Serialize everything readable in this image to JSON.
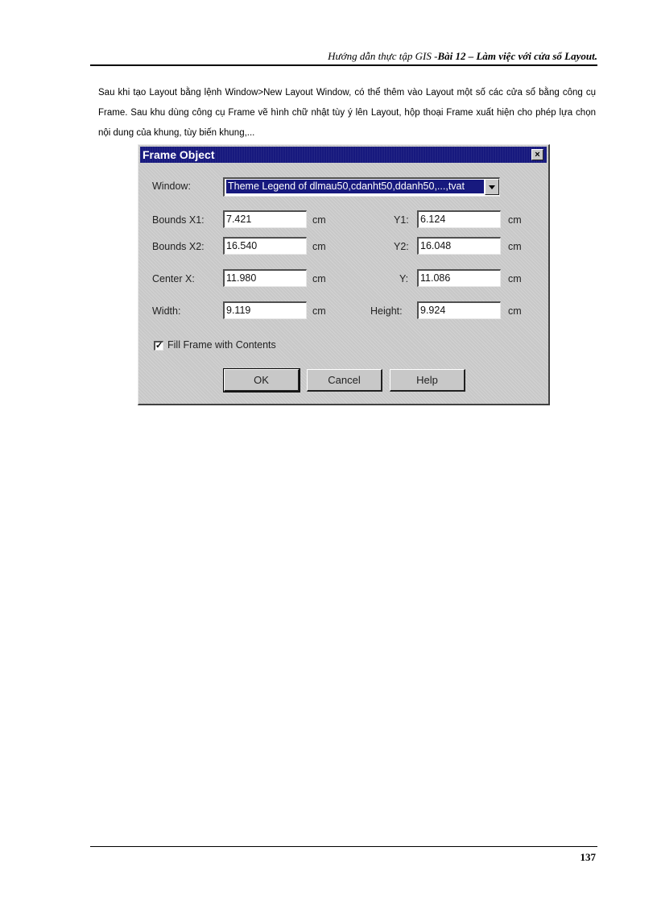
{
  "header": {
    "text_italic": "Hướng dẫn thực tập GIS -",
    "text_bold": "Bài 12 – Làm việc với cửa sổ Layout."
  },
  "intro": "Sau khi tạo Layout bằng lệnh Window>New Layout Window, có thể thêm vào Layout một số các cửa sổ bằng công cụ Frame. Sau khu dùng công cụ Frame vẽ hình chữ nhật tùy ý lên Layout, hộp thoại Frame xuất hiện cho phép lựa chọn nội dung của khung, tùy biến khung,...",
  "dialog": {
    "title": "Frame Object",
    "close_glyph": "×",
    "window_label": "Window:",
    "window_value": "Theme Legend of dlmau50,cdanht50,ddanh50,...,tvat",
    "bounds_x1_label": "Bounds X1:",
    "bounds_x1": "7.421",
    "y1_label": "Y1:",
    "y1": "6.124",
    "bounds_x2_label": "Bounds X2:",
    "bounds_x2": "16.540",
    "y2_label": "Y2:",
    "y2": "16.048",
    "center_x_label": "Center X:",
    "center_x": "11.980",
    "center_y_label": "Y:",
    "center_y": "11.086",
    "width_label": "Width:",
    "width": "9.119",
    "height_label": "Height:",
    "height": "9.924",
    "unit": "cm",
    "fill_label": "Fill Frame with Contents",
    "fill_checked": true,
    "ok_label": "OK",
    "cancel_label": "Cancel",
    "help_label": "Help"
  },
  "page_number": "137"
}
